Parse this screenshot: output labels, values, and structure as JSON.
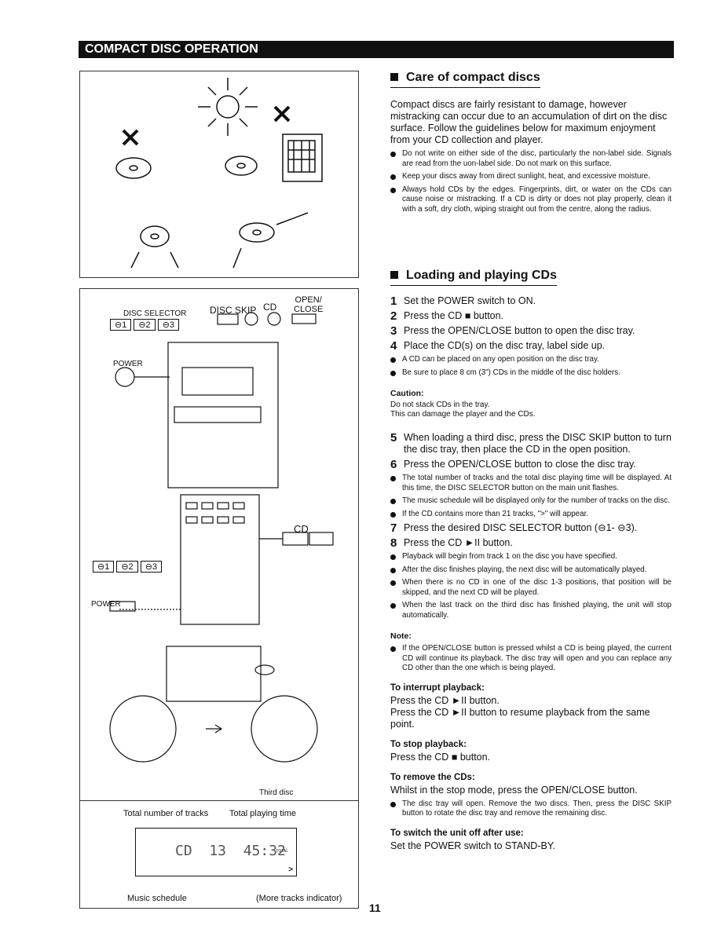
{
  "header": {
    "title": "COMPACT DISC OPERATION"
  },
  "page_number": "11",
  "diagram": {
    "disc_selector": "DISC SELECTOR",
    "disc_skip": "DISC SKIP",
    "cd": "CD",
    "open_close": "OPEN/\nCLOSE",
    "disc_buttons": [
      "⊖1",
      "⊖2",
      "⊖3"
    ],
    "power": "POWER",
    "remote_cd": "CD",
    "third_disc": "Third disc",
    "total_tracks_label": "Total number of tracks",
    "total_time_label": "Total playing time",
    "music_schedule_label": "Music schedule",
    "more_tracks_label": "(More tracks indicator)",
    "lcd_text": "CD  13  45:32",
    "lcd_total": "TOTAL"
  },
  "care": {
    "title": "Care of compact discs",
    "intro": "Compact discs are fairly resistant to damage, however mistracking can occur due to an accumulation of dirt on the disc surface. Follow the guidelines below for maximum enjoyment from your CD collection and player.",
    "bullets": [
      "Do not write on either side of the disc, particularly the non-label side. Signals are read from the uon-label side. Do not mark on this surface.",
      "Keep your discs away from direct sunlight, heat, and excessive moisture.",
      "Always hold CDs by the edges. Fingerprints, dirt, or water on the CDs can cause noise or mistracking. If a CD is dirty or does not play properly, clean it with a soft, dry cloth, wiping straight out from the centre, along the radius."
    ]
  },
  "loading": {
    "title": "Loading and playing CDs",
    "steps_a": [
      {
        "n": "1",
        "t": "Set the POWER switch to ON."
      },
      {
        "n": "2",
        "t": "Press the CD ■ button."
      },
      {
        "n": "3",
        "t": "Press the OPEN/CLOSE button to open the disc tray."
      },
      {
        "n": "4",
        "t": "Place the CD(s) on the disc tray, label side up."
      }
    ],
    "bullets_a": [
      "A CD can be placed on any open position on the disc tray.",
      "Be sure to place 8 cm (3\") CDs in the middle of the disc holders."
    ],
    "caution_title": "Caution:",
    "caution_lines": [
      "Do not stack CDs in the tray.",
      "This can damage the player and the CDs."
    ],
    "step5": {
      "n": "5",
      "t": "When loading a third disc, press the DISC SKIP button to turn the disc tray, then place the CD in the open position."
    },
    "step6": {
      "n": "6",
      "t": "Press the OPEN/CLOSE button to close the disc tray."
    },
    "bullets_6": [
      "The total number of tracks and the total disc playing time will be displayed. At this time, the DISC SELECTOR button on the main unit flashes.",
      "The music schedule will be displayed only for the number of tracks on the disc.",
      "If the CD contains more than 21 tracks, \">\" will appear."
    ],
    "step7": {
      "n": "7",
      "t": "Press the desired DISC SELECTOR button (⊖1- ⊖3)."
    },
    "step8": {
      "n": "8",
      "t": "Press the CD ►II button."
    },
    "bullets_8": [
      "Playback will begin from track 1 on the disc you have specified.",
      "After the disc finishes playing, the next disc will be automatically played.",
      "When there is no CD in one of the disc 1-3 positions, that position will be skipped, and the next CD will be played.",
      "When the last track on the third disc has finished playing, the unit will stop automatically."
    ],
    "note_title": "Note:",
    "note": "If the OPEN/CLOSE button is pressed whilst a CD is being played, the current CD will continue its playback. The disc tray will open and you can replace any CD other than the one which is being played.",
    "interrupt_title": "To interrupt playback:",
    "interrupt_lines": [
      "Press the CD ►II button.",
      "Press the CD ►II button to resume playback from the same point."
    ],
    "stop_title": "To stop playback:",
    "stop_text": "Press the  CD ■ button.",
    "remove_title": "To remove the CDs:",
    "remove_text": "Whilst in the stop mode, press the OPEN/CLOSE  button.",
    "remove_bullet": "The disc tray will open. Remove the two discs. Then, press the DISC SKIP button to rotate the disc tray and remove the remaining disc.",
    "off_title": "To switch the unit off after use:",
    "off_text": "Set the POWER switch to STAND-BY."
  }
}
